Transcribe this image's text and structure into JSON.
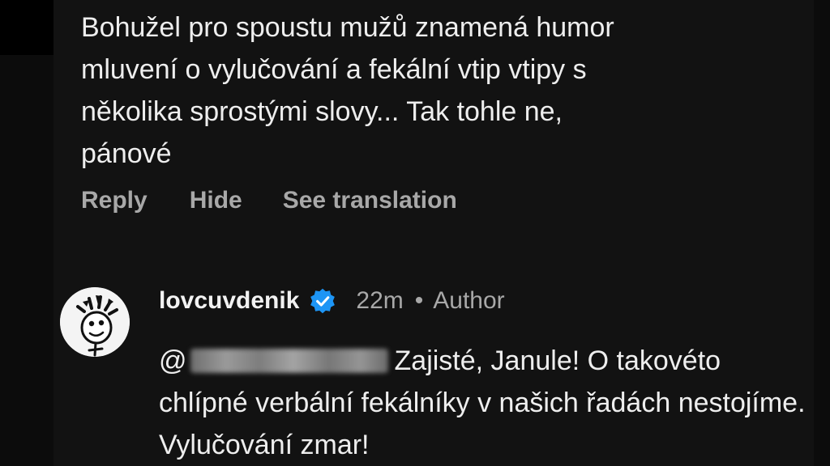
{
  "comment": {
    "text": "Bohužel pro spoustu mužů znamená humor\nmluvení o vylučování a fekální vtip vtipy s\nněkolika sprostými slovy... Tak tohle ne,\npánové",
    "actions": {
      "reply": "Reply",
      "hide": "Hide",
      "see_translation": "See translation"
    }
  },
  "reply": {
    "username": "lovcuvdenik",
    "time": "22m",
    "separator": "•",
    "role": "Author",
    "mention_prefix": "@",
    "text": "Zajisté, Janule! O takovéto chlípné verbální fekálníky v našich řadách nestojíme. Vylučování zmar!",
    "verified_icon": "verified-badge-icon",
    "avatar_icon": "cartoon-face-icon"
  },
  "colors": {
    "background": "#121212",
    "text_primary": "#eeeeee",
    "text_secondary": "#a8a8a8",
    "verified_blue": "#1d95f5"
  }
}
